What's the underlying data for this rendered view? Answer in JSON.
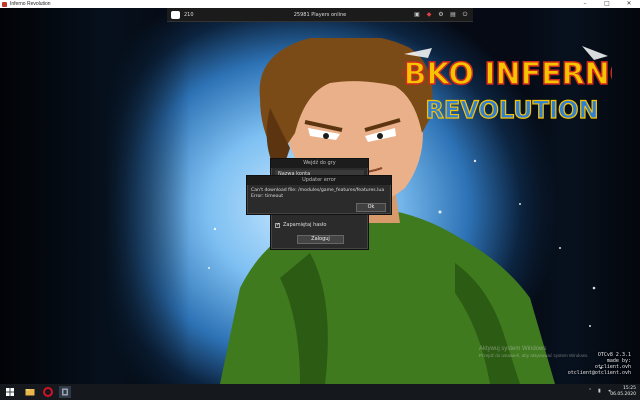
{
  "window": {
    "title": "Inferno Revolution",
    "controls": [
      "–",
      "□",
      "✕"
    ]
  },
  "client_bar": {
    "discord_count": "210",
    "players_online": "25981 Players online",
    "tools": [
      "▣",
      "◆",
      "⚙",
      "▤",
      "⏻"
    ]
  },
  "logo": {
    "line1": "DBKO INFERNO",
    "line2": "REVOLUTION"
  },
  "login_dialog": {
    "title": "Wejdź do gry",
    "server_label": "Nazwa konta",
    "remember_label": "Zapamiętaj hasło",
    "remember_checked": true,
    "checkbox_mark": "✓",
    "login_button": "Zaloguj"
  },
  "error_dialog": {
    "title": "Updater error",
    "line1": "Can't download file: /modules/game_features/features.lua",
    "line2": "Error: timeout",
    "ok_button": "Ok"
  },
  "watermark": {
    "line1": "Aktywuj system Windows",
    "line2": "Przejdź do ustawień, aby aktywować system Windows."
  },
  "version": {
    "line1": "OTCv8 2.3.1",
    "line2": "made by:",
    "line3": "otclient.ovh",
    "line4": "otclient@otclient.ovh"
  },
  "taskbar": {
    "items": [
      "start-button",
      "search",
      "file-explorer",
      "opera",
      "inferno-app"
    ],
    "clock_time": "15:25",
    "clock_date": "06.05.2020"
  },
  "colors": {
    "logo_yellow": "#f5c400",
    "logo_red": "#d22a1e",
    "logo_blue": "#2f7fd8",
    "shirt_green": "#3f7a1f"
  }
}
